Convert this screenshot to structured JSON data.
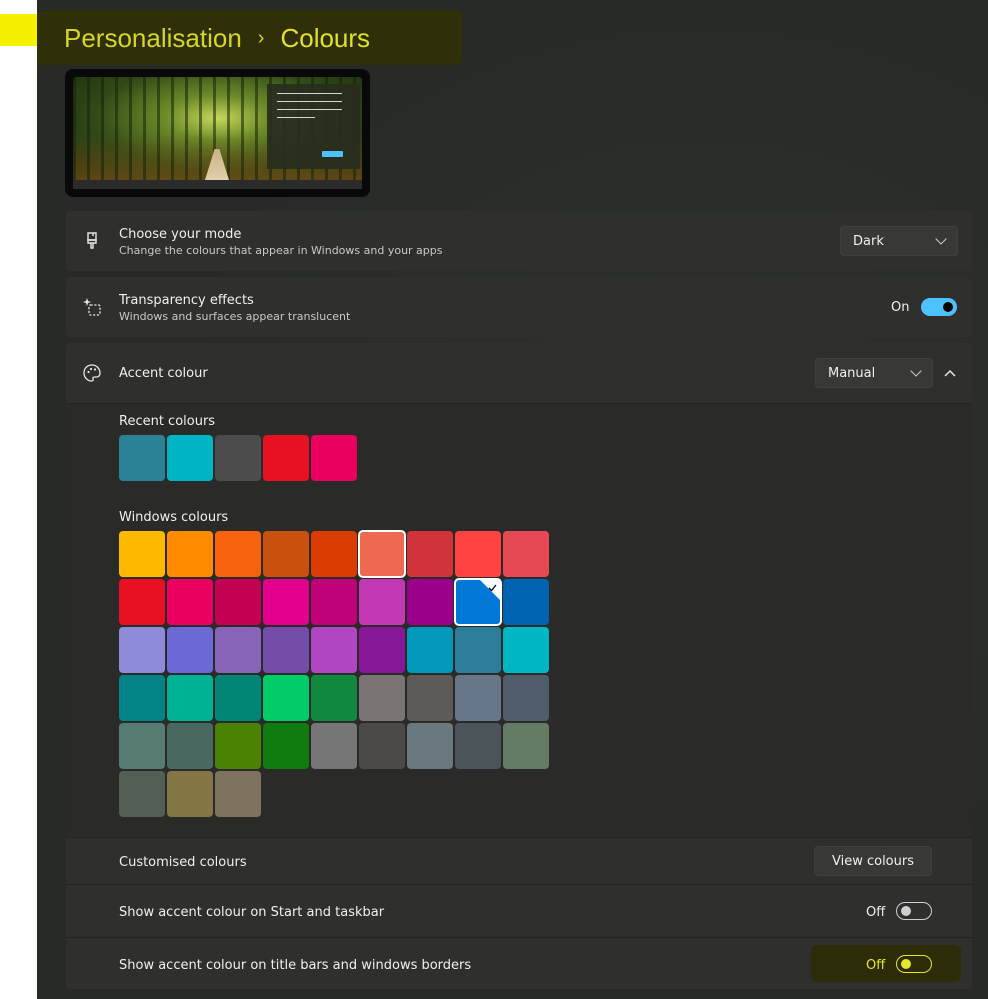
{
  "breadcrumb": {
    "parent": "Personalisation",
    "separator": "›",
    "current": "Colours"
  },
  "mode": {
    "title": "Choose your mode",
    "subtitle": "Change the colours that appear in Windows and your apps",
    "value": "Dark",
    "icon": "paintbrush-icon"
  },
  "transparency": {
    "title": "Transparency effects",
    "subtitle": "Windows and surfaces appear translucent",
    "state_label": "On",
    "on": true,
    "icon": "transparency-sparkle-icon"
  },
  "accent": {
    "title": "Accent colour",
    "value": "Manual",
    "icon": "palette-icon",
    "recent_label": "Recent colours",
    "recent": [
      "#2b8297",
      "#00b5c3",
      "#4c4c4c",
      "#e81123",
      "#ea005e"
    ],
    "windows_label": "Windows colours",
    "windows": [
      [
        "#ffb900",
        "#ff8c00",
        "#f7630c",
        "#ca5010",
        "#da3b01",
        "#ef6950",
        "#d13438",
        "#ff4343",
        "#e74856"
      ],
      [
        "#e81123",
        "#ea005e",
        "#c30052",
        "#e3008c",
        "#bf0077",
        "#c239b3",
        "#9a0089",
        "#0078d7",
        "#0063b1"
      ],
      [
        "#8e8cd8",
        "#6b69d6",
        "#8764b8",
        "#744da9",
        "#b146c2",
        "#881798",
        "#0099bc",
        "#2d7d9a",
        "#00b7c3"
      ],
      [
        "#038387",
        "#00b294",
        "#018574",
        "#00cc6a",
        "#10893e",
        "#7a7574",
        "#5d5a58",
        "#68768a",
        "#515c6b"
      ],
      [
        "#567c73",
        "#486860",
        "#498205",
        "#107c10",
        "#767676",
        "#4c4a48",
        "#69797e",
        "#4a5459",
        "#647c64"
      ],
      [
        "#525e54",
        "#847545",
        "#7e735f"
      ]
    ],
    "selected_hover": "#ef6950",
    "selected_checked": "#0078d7"
  },
  "custom": {
    "label": "Customised colours",
    "button": "View colours"
  },
  "start_taskbar": {
    "label": "Show accent colour on Start and taskbar",
    "state_label": "Off",
    "on": false
  },
  "title_bars": {
    "label": "Show accent colour on title bars and windows borders",
    "state_label": "Off",
    "on": false
  },
  "colors": {
    "highlight": "#f5f000",
    "toggle_on": "#4cc2ff",
    "title_text": "#d6d62a"
  }
}
